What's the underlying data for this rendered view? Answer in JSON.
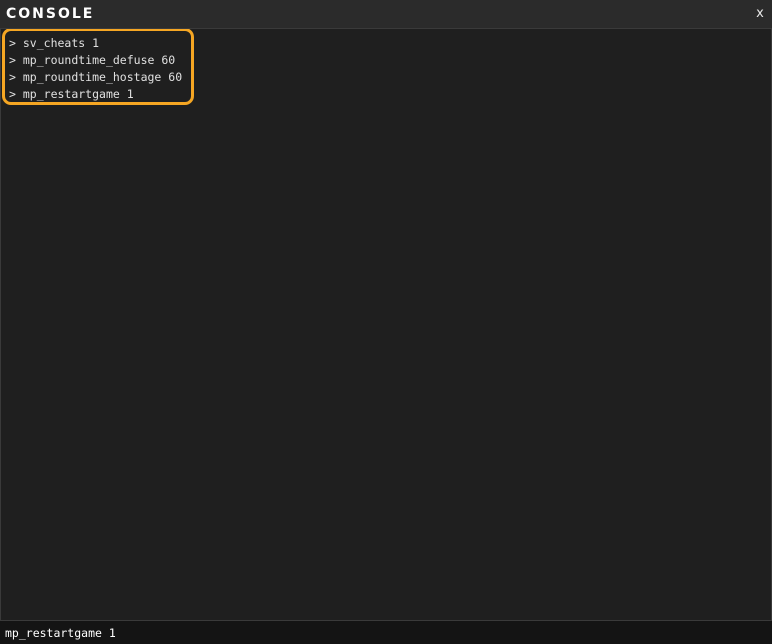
{
  "window": {
    "title": "CONSOLE",
    "close_label": "x"
  },
  "output": {
    "lines": [
      {
        "prompt": ">",
        "text": "sv_cheats 1"
      },
      {
        "prompt": ">",
        "text": "mp_roundtime_defuse 60"
      },
      {
        "prompt": ">",
        "text": "mp_roundtime_hostage 60"
      },
      {
        "prompt": ">",
        "text": "mp_restartgame 1"
      }
    ]
  },
  "input": {
    "value": "mp_restartgame 1"
  },
  "colors": {
    "highlight": "#f5a623",
    "background": "#1f1f1f",
    "input_background": "#141414"
  }
}
